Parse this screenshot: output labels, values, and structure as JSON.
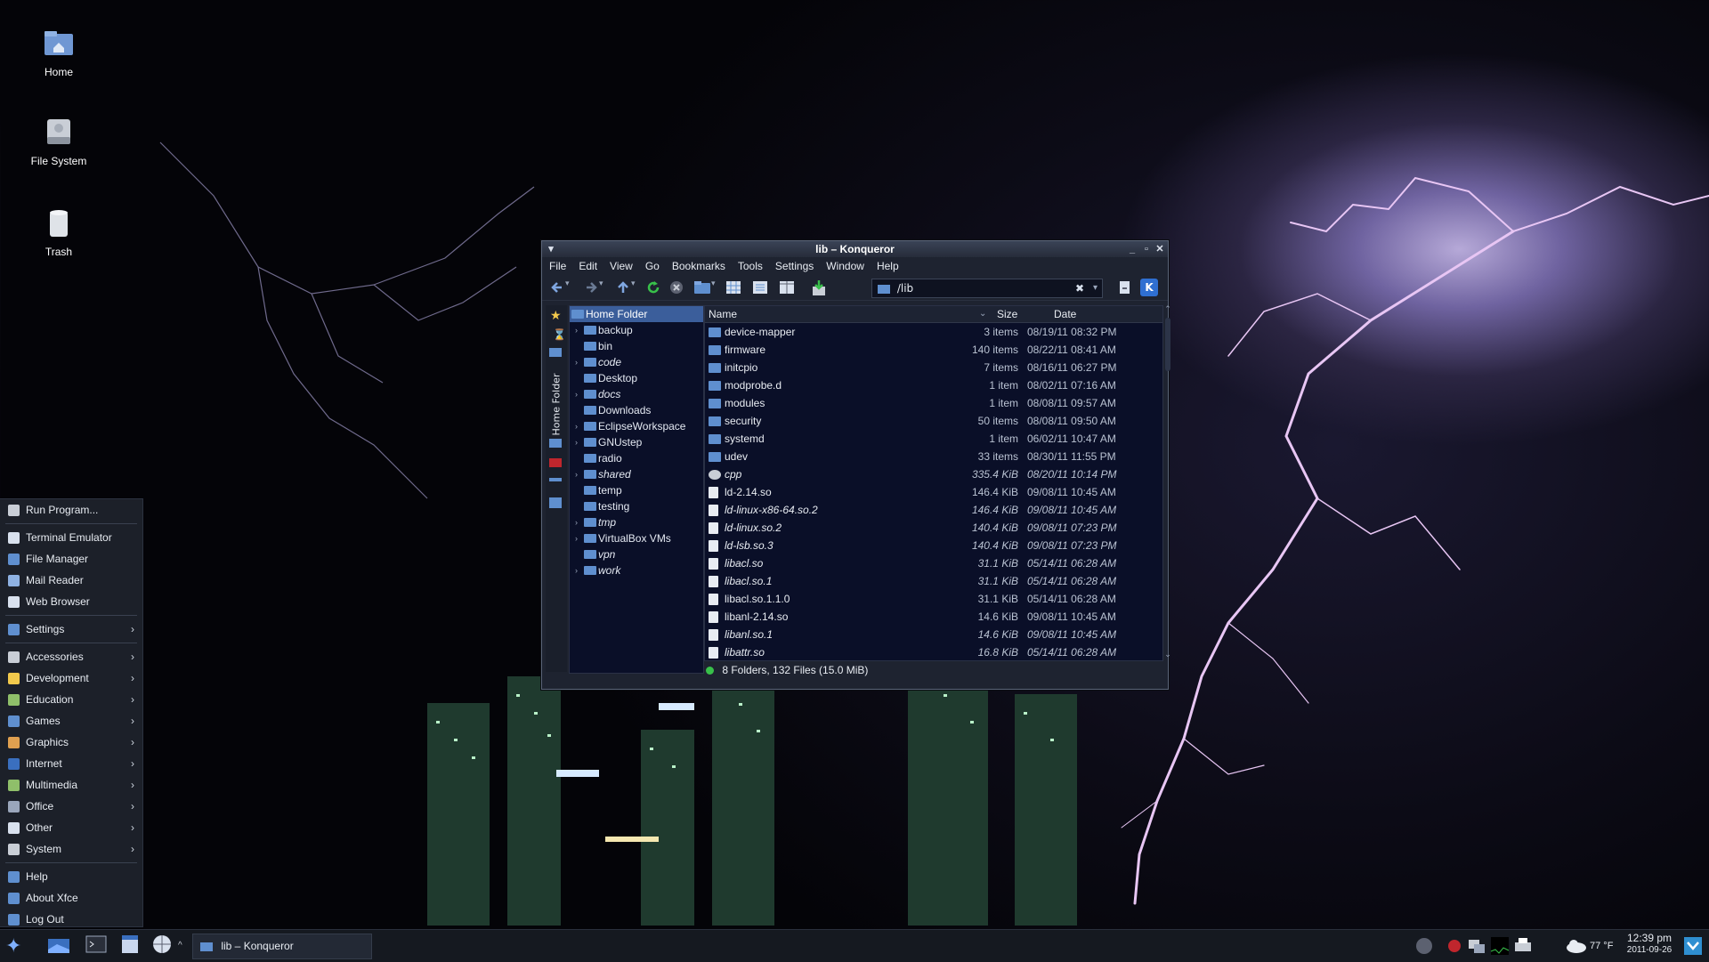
{
  "desktop": {
    "icons": [
      {
        "label": "Home",
        "icon": "home-folder-icon"
      },
      {
        "label": "File System",
        "icon": "drive-icon"
      },
      {
        "label": "Trash",
        "icon": "trash-icon"
      }
    ]
  },
  "start_menu": {
    "items": [
      {
        "label": "Run Program...",
        "icon": "gear-icon",
        "submenu": false
      },
      {
        "label": "Terminal Emulator",
        "icon": "terminal-icon",
        "submenu": false
      },
      {
        "label": "File Manager",
        "icon": "file-manager-icon",
        "submenu": false
      },
      {
        "label": "Mail Reader",
        "icon": "mail-icon",
        "submenu": false
      },
      {
        "label": "Web Browser",
        "icon": "globe-icon",
        "submenu": false
      },
      {
        "label": "Settings",
        "icon": "settings-icon",
        "submenu": true
      },
      {
        "label": "Accessories",
        "icon": "accessories-icon",
        "submenu": true
      },
      {
        "label": "Development",
        "icon": "development-icon",
        "submenu": true
      },
      {
        "label": "Education",
        "icon": "education-icon",
        "submenu": true
      },
      {
        "label": "Games",
        "icon": "games-icon",
        "submenu": true
      },
      {
        "label": "Graphics",
        "icon": "graphics-icon",
        "submenu": true
      },
      {
        "label": "Internet",
        "icon": "internet-icon",
        "submenu": true
      },
      {
        "label": "Multimedia",
        "icon": "multimedia-icon",
        "submenu": true
      },
      {
        "label": "Office",
        "icon": "office-icon",
        "submenu": true
      },
      {
        "label": "Other",
        "icon": "other-icon",
        "submenu": true
      },
      {
        "label": "System",
        "icon": "system-icon",
        "submenu": true
      },
      {
        "label": "Help",
        "icon": "help-icon",
        "submenu": false
      },
      {
        "label": "About Xfce",
        "icon": "info-icon",
        "submenu": false
      },
      {
        "label": "Log Out",
        "icon": "logout-icon",
        "submenu": false
      }
    ]
  },
  "window": {
    "title": "lib – Konqueror",
    "menubar": [
      "File",
      "Edit",
      "View",
      "Go",
      "Bookmarks",
      "Tools",
      "Settings",
      "Window",
      "Help"
    ],
    "location": "/lib",
    "sidebar_tab": "Home Folder",
    "tree": {
      "root": "Home Folder",
      "items": [
        {
          "label": "backup",
          "expandable": true,
          "italic": false
        },
        {
          "label": "bin",
          "expandable": false,
          "italic": false
        },
        {
          "label": "code",
          "expandable": true,
          "italic": true
        },
        {
          "label": "Desktop",
          "expandable": false,
          "italic": false
        },
        {
          "label": "docs",
          "expandable": true,
          "italic": true
        },
        {
          "label": "Downloads",
          "expandable": false,
          "italic": false
        },
        {
          "label": "EclipseWorkspace",
          "expandable": true,
          "italic": false
        },
        {
          "label": "GNUstep",
          "expandable": true,
          "italic": false
        },
        {
          "label": "radio",
          "expandable": false,
          "italic": false
        },
        {
          "label": "shared",
          "expandable": true,
          "italic": true
        },
        {
          "label": "temp",
          "expandable": false,
          "italic": false
        },
        {
          "label": "testing",
          "expandable": false,
          "italic": false
        },
        {
          "label": "tmp",
          "expandable": true,
          "italic": true
        },
        {
          "label": "VirtualBox VMs",
          "expandable": true,
          "italic": false
        },
        {
          "label": "vpn",
          "expandable": false,
          "italic": true
        },
        {
          "label": "work",
          "expandable": true,
          "italic": true
        }
      ]
    },
    "list": {
      "columns": [
        "Name",
        "Size",
        "Date"
      ],
      "rows": [
        {
          "name": "device-mapper",
          "size": "3 items",
          "date": "08/19/11 08:32 PM",
          "type": "folder",
          "italic": false
        },
        {
          "name": "firmware",
          "size": "140 items",
          "date": "08/22/11 08:41 AM",
          "type": "folder",
          "italic": false
        },
        {
          "name": "initcpio",
          "size": "7 items",
          "date": "08/16/11 06:27 PM",
          "type": "folder",
          "italic": false
        },
        {
          "name": "modprobe.d",
          "size": "1 item",
          "date": "08/02/11 07:16 AM",
          "type": "folder",
          "italic": false
        },
        {
          "name": "modules",
          "size": "1 item",
          "date": "08/08/11 09:57 AM",
          "type": "folder",
          "italic": false
        },
        {
          "name": "security",
          "size": "50 items",
          "date": "08/08/11 09:50 AM",
          "type": "folder",
          "italic": false
        },
        {
          "name": "systemd",
          "size": "1 item",
          "date": "06/02/11 10:47 AM",
          "type": "folder",
          "italic": false
        },
        {
          "name": "udev",
          "size": "33 items",
          "date": "08/30/11 11:55 PM",
          "type": "folder",
          "italic": false
        },
        {
          "name": "cpp",
          "size": "335.4 KiB",
          "date": "08/20/11 10:14 PM",
          "type": "exec",
          "italic": true
        },
        {
          "name": "ld-2.14.so",
          "size": "146.4 KiB",
          "date": "09/08/11 10:45 AM",
          "type": "file",
          "italic": false
        },
        {
          "name": "ld-linux-x86-64.so.2",
          "size": "146.4 KiB",
          "date": "09/08/11 10:45 AM",
          "type": "file",
          "italic": true
        },
        {
          "name": "ld-linux.so.2",
          "size": "140.4 KiB",
          "date": "09/08/11 07:23 PM",
          "type": "file",
          "italic": true
        },
        {
          "name": "ld-lsb.so.3",
          "size": "140.4 KiB",
          "date": "09/08/11 07:23 PM",
          "type": "file",
          "italic": true
        },
        {
          "name": "libacl.so",
          "size": "31.1 KiB",
          "date": "05/14/11 06:28 AM",
          "type": "file",
          "italic": true
        },
        {
          "name": "libacl.so.1",
          "size": "31.1 KiB",
          "date": "05/14/11 06:28 AM",
          "type": "file",
          "italic": true
        },
        {
          "name": "libacl.so.1.1.0",
          "size": "31.1 KiB",
          "date": "05/14/11 06:28 AM",
          "type": "file",
          "italic": false
        },
        {
          "name": "libanl-2.14.so",
          "size": "14.6 KiB",
          "date": "09/08/11 10:45 AM",
          "type": "file",
          "italic": false
        },
        {
          "name": "libanl.so.1",
          "size": "14.6 KiB",
          "date": "09/08/11 10:45 AM",
          "type": "file",
          "italic": true
        },
        {
          "name": "libattr.so",
          "size": "16.8 KiB",
          "date": "05/14/11 06:28 AM",
          "type": "file",
          "italic": true
        }
      ]
    },
    "status": "8 Folders, 132 Files (15.0 MiB)"
  },
  "taskbar": {
    "task_label": "lib – Konqueror",
    "weather": "77 °F",
    "time": "12:39 pm",
    "date": "2011-09-26"
  },
  "colors": {
    "accent": "#3b5e9b",
    "panel": "#1c2029",
    "view_bg": "#0a0f28",
    "folder": "#5f8fcf"
  }
}
